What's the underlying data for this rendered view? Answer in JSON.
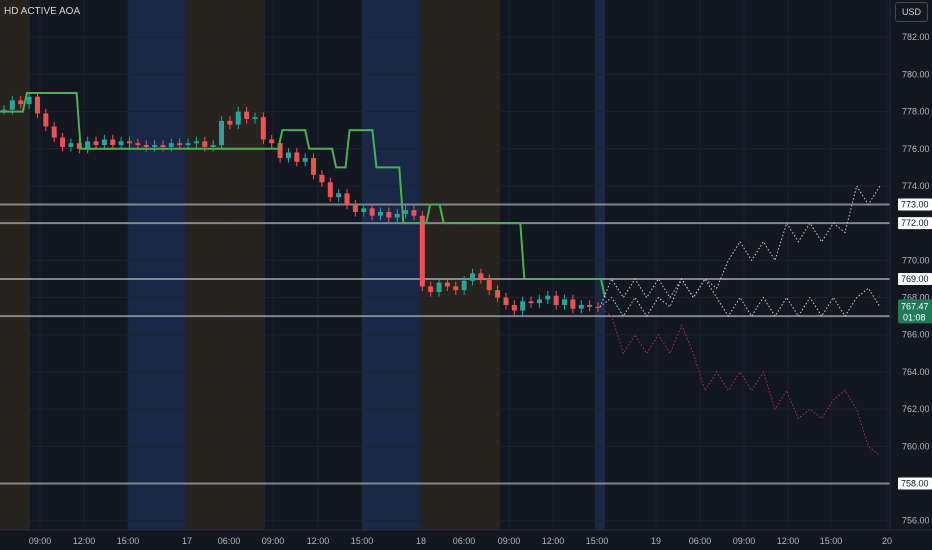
{
  "header": {
    "symbol": "HD ACTIVE AOA",
    "currency": "USD"
  },
  "colors": {
    "background": "#131722",
    "session_premarket": "#2a2620",
    "session_afterhours": "#1a2a4a",
    "up_candle": "#26a69a",
    "down_candle": "#ef5350",
    "avg_line": "#4caf50",
    "level_line": "#9598a1",
    "price_badge": "#1f7a5a",
    "forecast_up": "#c8c8c8",
    "forecast_down": "#b0304a"
  },
  "chart_data": {
    "type": "candlestick",
    "y_range": [
      755.5,
      784
    ],
    "y_ticks": [
      "782.00",
      "780.00",
      "778.00",
      "776.00",
      "774.00",
      "772.00",
      "770.00",
      "768.00",
      "766.00",
      "764.00",
      "762.00",
      "760.00",
      "758.00",
      "756.00"
    ],
    "x_ticks": [
      "09:00",
      "12:00",
      "15:00",
      "17",
      "06:00",
      "09:00",
      "12:00",
      "15:00",
      "18",
      "06:00",
      "09:00",
      "12:00",
      "15:00",
      "19",
      "06:00",
      "09:00",
      "12:00",
      "15:00",
      "20"
    ],
    "level_labels": [
      "773.00",
      "772.00",
      "769.00",
      "758.00"
    ],
    "levels": [
      773.0,
      772.0,
      769.0,
      767.0,
      758.0
    ],
    "last_price": "767.47",
    "countdown": "01:08",
    "close_series": [
      778.1,
      778.6,
      778.4,
      778.8,
      777.9,
      777.2,
      776.6,
      776.1,
      776.3,
      776.0,
      776.4,
      776.2,
      776.5,
      776.2,
      776.4,
      776.3,
      776.2,
      776.1,
      776.2,
      776.1,
      776.3,
      776.2,
      776.3,
      776.4,
      776.1,
      776.2,
      777.5,
      777.3,
      778.0,
      777.6,
      777.7,
      776.5,
      776.3,
      775.5,
      775.8,
      775.3,
      775.5,
      774.6,
      774.2,
      773.4,
      773.6,
      773.0,
      772.6,
      772.8,
      772.4,
      772.6,
      772.3,
      772.5,
      772.7,
      772.4,
      768.6,
      768.3,
      768.8,
      768.6,
      768.4,
      768.9,
      769.3,
      769.0,
      768.4,
      768.0,
      767.6,
      767.3,
      767.8,
      767.7,
      767.9,
      768.1,
      767.6,
      767.9,
      767.4,
      767.6,
      767.5,
      767.47
    ],
    "avg_series": [
      778.0,
      778.0,
      779.0,
      779.0,
      779.0,
      779.0,
      776.0,
      776.0,
      776.0,
      776.0,
      776.0,
      776.0,
      776.0,
      776.0,
      776.0,
      776.0,
      776.0,
      776.0,
      776.0,
      776.0,
      776.0,
      777.0,
      777.0,
      776.0,
      776.0,
      775.0,
      777.0,
      777.0,
      775.0,
      775.0,
      772.0,
      772.0,
      773.0,
      772.0,
      772.0,
      772.0,
      772.0,
      772.0,
      772.0,
      769.0,
      769.0,
      769.0,
      769.0,
      769.0,
      769.0,
      768.0
    ],
    "forecast_upper": [
      767.5,
      769.0,
      768.0,
      769.0,
      768.0,
      769.0,
      768.0,
      769.0,
      768.0,
      769.0,
      768.5,
      770.0,
      771.0,
      770.0,
      771.0,
      770.0,
      772.0,
      771.0,
      772.0,
      771.0,
      772.0,
      771.5,
      774.0,
      773.0,
      774.0
    ],
    "forecast_mid": [
      767.5,
      768.0,
      767.0,
      768.0,
      767.0,
      768.0,
      767.5,
      769.0,
      768.0,
      769.0,
      768.0,
      767.0,
      768.0,
      767.0,
      768.0,
      767.0,
      768.0,
      767.0,
      768.0,
      767.0,
      768.0,
      767.0,
      768.0,
      768.5,
      767.5
    ],
    "forecast_lower": [
      767.5,
      767.0,
      765.0,
      766.0,
      765.0,
      766.0,
      765.0,
      766.5,
      765.0,
      763.0,
      764.0,
      763.0,
      764.0,
      763.0,
      764.0,
      762.0,
      763.0,
      761.5,
      762.0,
      761.5,
      762.5,
      763.0,
      762.0,
      760.0,
      759.5
    ]
  }
}
